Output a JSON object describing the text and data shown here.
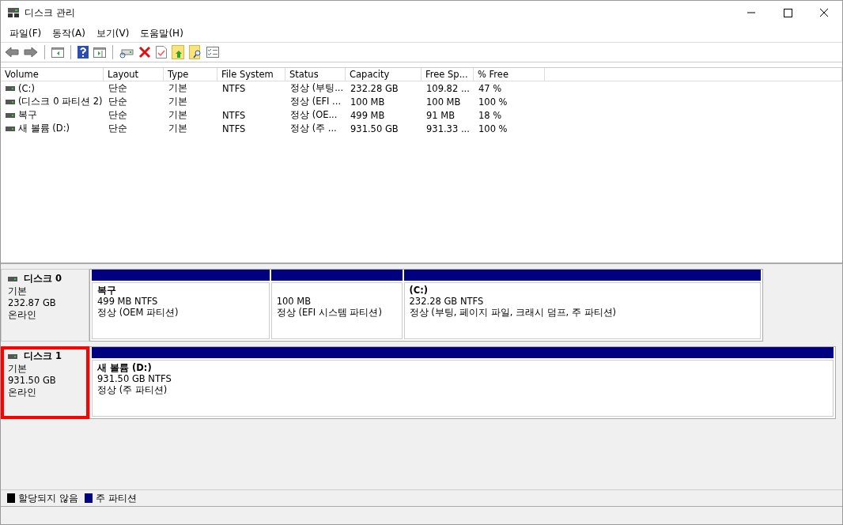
{
  "window": {
    "title": "디스크 관리"
  },
  "menu": [
    "파일(F)",
    "동작(A)",
    "보기(V)",
    "도움말(H)"
  ],
  "table": {
    "columns": [
      "Volume",
      "Layout",
      "Type",
      "File System",
      "Status",
      "Capacity",
      "Free Sp...",
      "% Free"
    ],
    "rows": [
      [
        "(C:)",
        "단순",
        "기본",
        "NTFS",
        "정상 (부팅...",
        "232.28 GB",
        "109.82 ...",
        "47 %"
      ],
      [
        "(디스크 0 파티션 2)",
        "단순",
        "기본",
        "",
        "정상 (EFI ...",
        "100 MB",
        "100 MB",
        "100 %"
      ],
      [
        "복구",
        "단순",
        "기본",
        "NTFS",
        "정상 (OE...",
        "499 MB",
        "91 MB",
        "18 %"
      ],
      [
        "새 볼륨 (D:)",
        "단순",
        "기본",
        "NTFS",
        "정상 (주 ...",
        "931.50 GB",
        "931.33 ...",
        "100 %"
      ]
    ]
  },
  "disks": [
    {
      "name": "디스크 0",
      "type": "기본",
      "size": "232.87 GB",
      "state": "온라인",
      "highlighted": false,
      "partitions": [
        {
          "name": "복구",
          "size": "499 MB NTFS",
          "status": "정상 (OEM 파티션)"
        },
        {
          "size": "100 MB",
          "status": "정상 (EFI 시스템 파티션)"
        },
        {
          "name": "(C:)",
          "size": "232.28 GB NTFS",
          "status": "정상 (부팅, 페이지 파일, 크래시 덤프, 주 파티션)"
        }
      ]
    },
    {
      "name": "디스크 1",
      "type": "기본",
      "size": "931.50 GB",
      "state": "온라인",
      "highlighted": true,
      "partitions": [
        {
          "name": "새 볼륨  (D:)",
          "size": "931.50 GB NTFS",
          "status": "정상 (주 파티션)"
        }
      ]
    }
  ],
  "legend": [
    {
      "label": "할당되지 않음",
      "color": "#000000"
    },
    {
      "label": "주 파티션",
      "color": "#000080"
    }
  ]
}
